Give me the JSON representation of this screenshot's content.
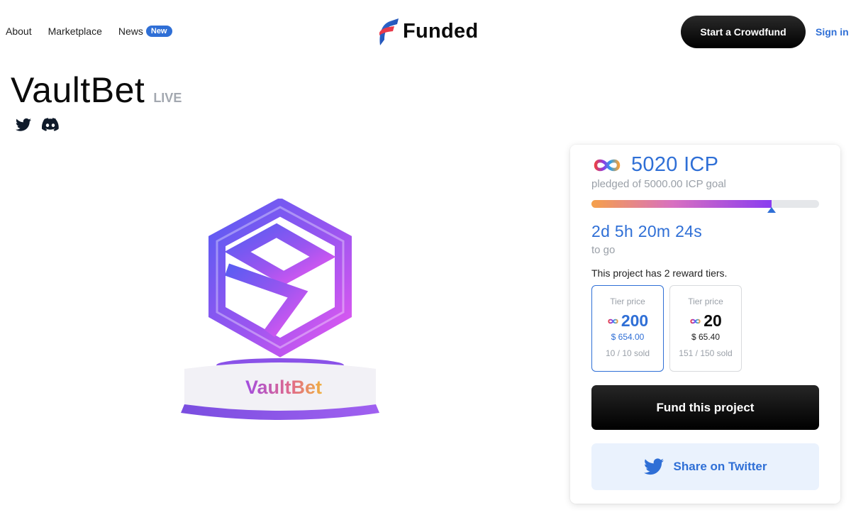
{
  "nav": {
    "about": "About",
    "marketplace": "Marketplace",
    "news": "News",
    "news_badge": "New"
  },
  "brand": {
    "name": "Funded"
  },
  "header": {
    "cta": "Start a Crowdfund",
    "signin": "Sign in"
  },
  "project": {
    "name": "VaultBet",
    "status": "LIVE",
    "art_label": "VaultBet"
  },
  "funding": {
    "amount": "5020 ICP",
    "pledged_text": "pledged of 5000.00 ICP goal",
    "progress_fraction": 0.79,
    "countdown": "2d 5h 20m 24s",
    "togo": "to go",
    "tiers_note": "This project has 2 reward tiers."
  },
  "tiers": [
    {
      "label": "Tier price",
      "price": "200",
      "usd": "$ 654.00",
      "sold": "10 / 10 sold"
    },
    {
      "label": "Tier price",
      "price": "20",
      "usd": "$ 65.40",
      "sold": "151 / 150 sold"
    }
  ],
  "actions": {
    "fund": "Fund this project",
    "share": "Share on Twitter"
  },
  "colors": {
    "accent": "#2f6fd6",
    "muted": "#9aa0a8",
    "dark": "#000000"
  }
}
